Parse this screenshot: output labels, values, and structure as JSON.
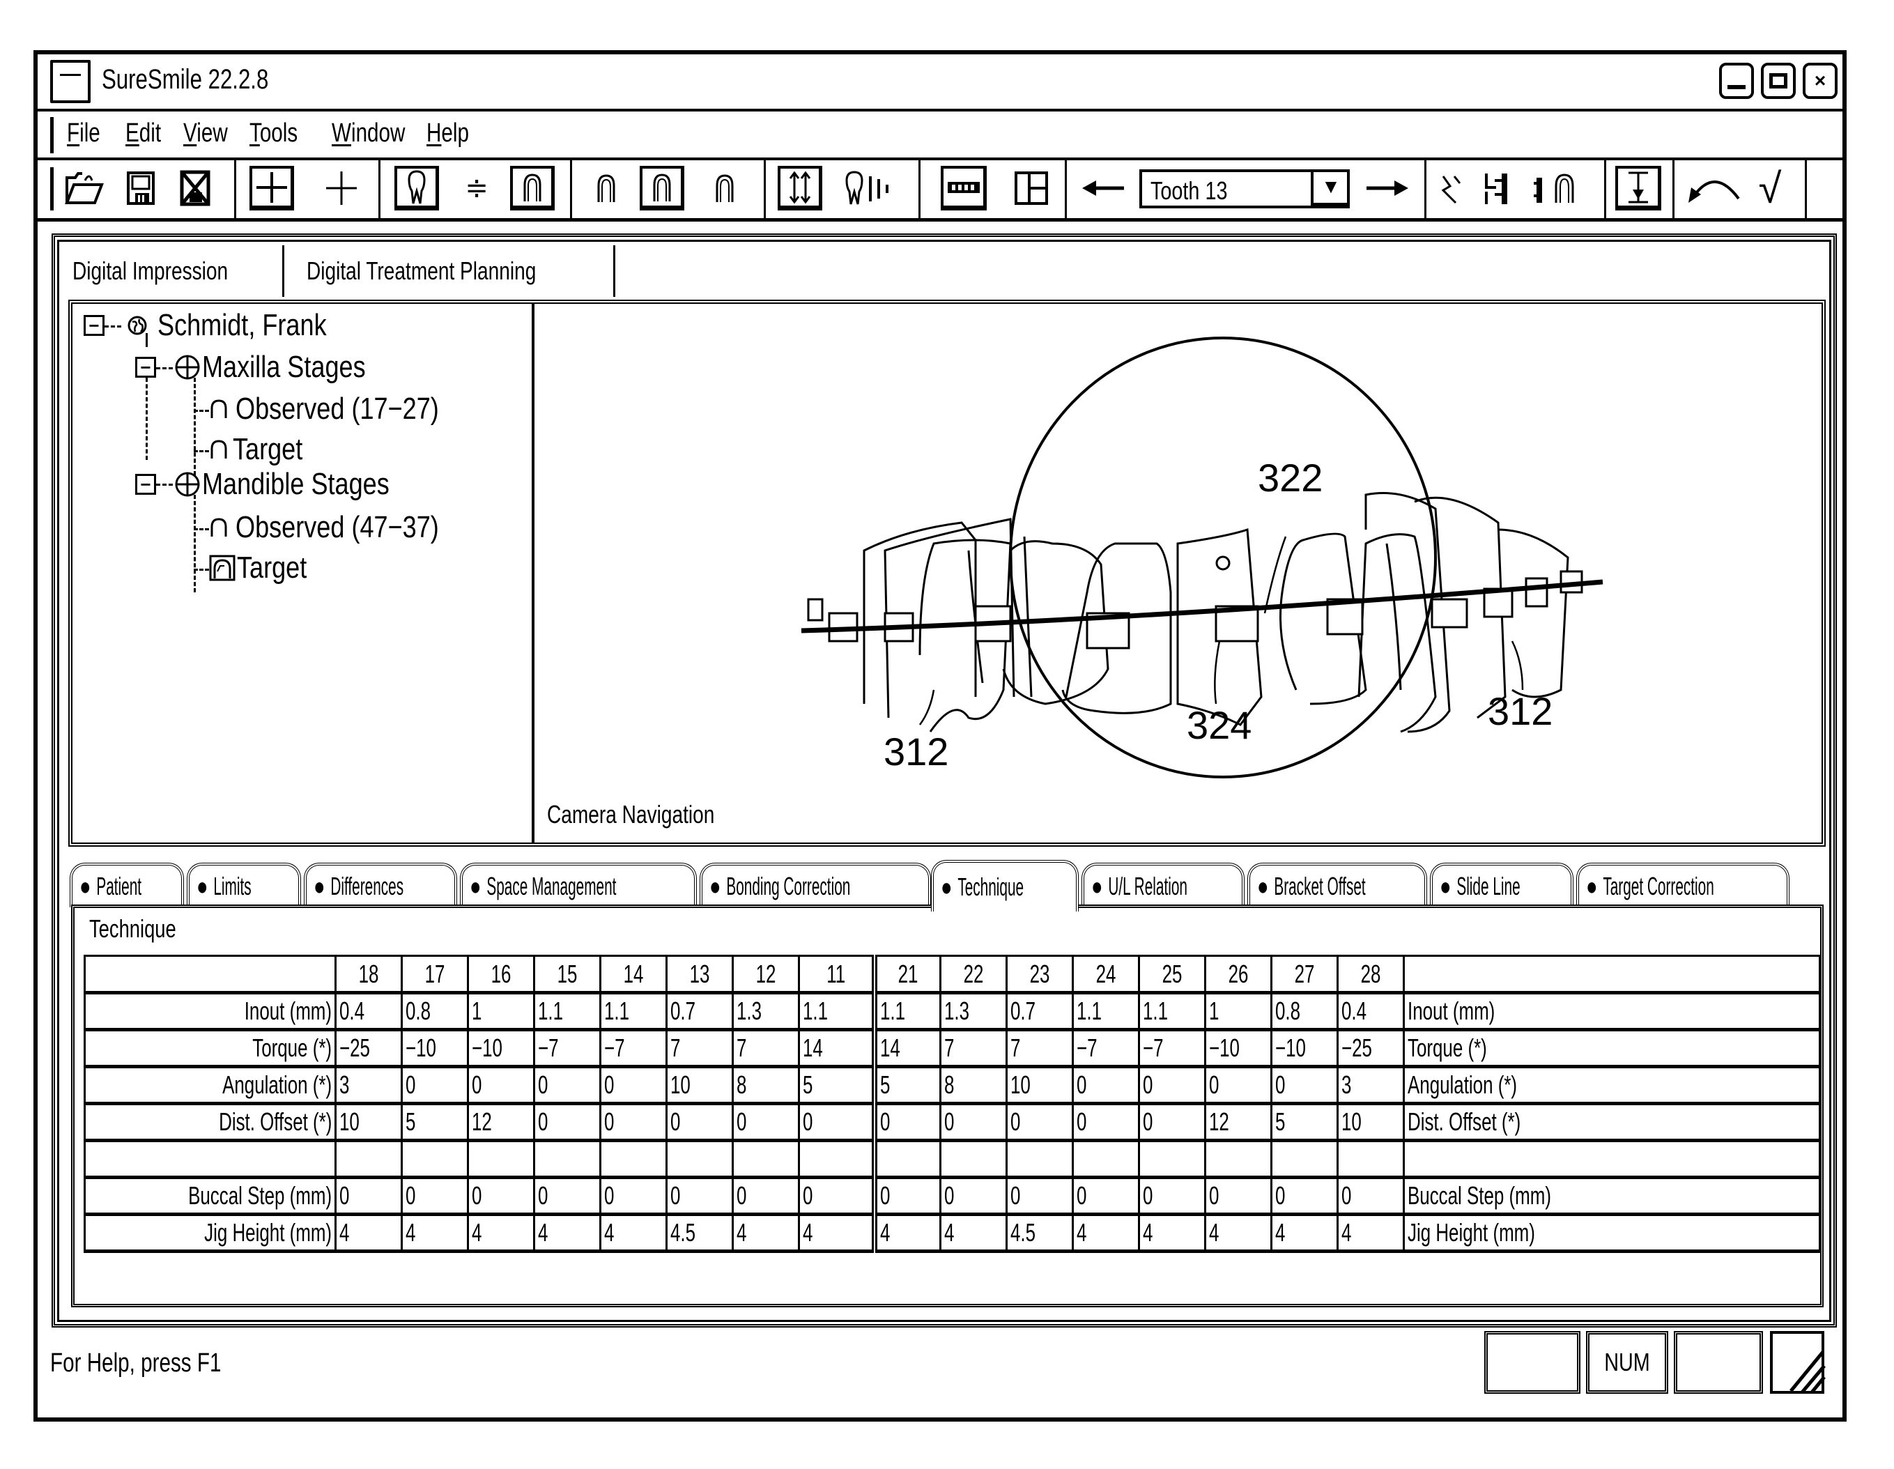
{
  "window": {
    "title": "SureSmile 22.2.8",
    "controls": {
      "minimize": "_",
      "maximize": "□",
      "close": "×"
    }
  },
  "menu": [
    {
      "label": "File",
      "mnemonic": "F",
      "rest": "ile"
    },
    {
      "label": "Edit",
      "mnemonic": "E",
      "rest": "dit"
    },
    {
      "label": "View",
      "mnemonic": "V",
      "rest": "iew"
    },
    {
      "label": "Tools",
      "mnemonic": "T",
      "rest": "ools"
    },
    {
      "label": "Window",
      "mnemonic": "W",
      "rest": "indow"
    },
    {
      "label": "Help",
      "mnemonic": "H",
      "rest": "elp"
    }
  ],
  "toolbar": {
    "icons": {
      "open": "open-folder-icon",
      "save": "save-icon",
      "close_doc": "close-document-icon",
      "add_boxed": "add-boxed-icon",
      "add": "add-icon",
      "tooth": "tooth-icon",
      "not_equal": "not-equal-icon",
      "arch_boxed": "arch-boxed-icon",
      "arch_upper": "arch-upper-icon",
      "arch_mid": "arch-boxed-icon",
      "arch_lower": "arch-lower-icon",
      "vertical_arrows": "vertical-arrows-icon",
      "tooth_ruler": "tooth-ruler-icon",
      "bracket_strip": "bracket-strip-icon",
      "split_view": "split-view-icon",
      "prev": "arrow-left-icon",
      "next": "arrow-right-icon",
      "wire_bend": "wire-bend-icon",
      "bracket_pair": "bracket-pair-icon",
      "bracket_arch": "bracket-arch-icon",
      "jig_down": "jig-down-icon",
      "undo": "undo-icon",
      "accept": "checkmark-icon"
    },
    "tooth_select": {
      "value": "Tooth 13",
      "dropdown": "▼"
    },
    "glyphs": {
      "prev": "←",
      "next": "→",
      "check": "√",
      "not_equal": "≑"
    }
  },
  "main_tabs": [
    {
      "label": "Digital Impression"
    },
    {
      "label": "Digital Treatment Planning"
    }
  ],
  "tree": {
    "root": "Schmidt, Frank",
    "maxilla": "Maxilla Stages",
    "maxilla_observed": "Observed (17−27)",
    "maxilla_target": "Target",
    "mandible": "Mandible Stages",
    "mandible_observed": "Observed (47−37)",
    "mandible_target": "Target",
    "expander": "−"
  },
  "viewport": {
    "label": "Camera Navigation",
    "callouts": [
      "322",
      "324",
      "312",
      "312"
    ]
  },
  "bottom_tabs": [
    {
      "label": "Patient"
    },
    {
      "label": "Limits"
    },
    {
      "label": "Differences"
    },
    {
      "label": "Space Management"
    },
    {
      "label": "Bonding Correction"
    },
    {
      "label": "Technique",
      "active": true
    },
    {
      "label": "U/L Relation"
    },
    {
      "label": "Bracket Offset"
    },
    {
      "label": "Slide Line"
    },
    {
      "label": "Target Correction"
    }
  ],
  "technique": {
    "title": "Technique",
    "teeth": [
      "18",
      "17",
      "16",
      "15",
      "14",
      "13",
      "12",
      "11",
      "21",
      "22",
      "23",
      "24",
      "25",
      "26",
      "27",
      "28"
    ],
    "rows": [
      {
        "label": "Inout (mm)",
        "values": [
          "0.4",
          "0.8",
          "1",
          "1.1",
          "1.1",
          "0.7",
          "1.3",
          "1.1",
          "1.1",
          "1.3",
          "0.7",
          "1.1",
          "1.1",
          "1",
          "0.8",
          "0.4"
        ]
      },
      {
        "label": "Torque (*)",
        "values": [
          "−25",
          "−10",
          "−10",
          "−7",
          "−7",
          "7",
          "7",
          "14",
          "14",
          "7",
          "7",
          "−7",
          "−7",
          "−10",
          "−10",
          "−25"
        ]
      },
      {
        "label": "Angulation (*)",
        "values": [
          "3",
          "0",
          "0",
          "0",
          "0",
          "10",
          "8",
          "5",
          "5",
          "8",
          "10",
          "0",
          "0",
          "0",
          "0",
          "3"
        ]
      },
      {
        "label": "Dist. Offset (*)",
        "values": [
          "10",
          "5",
          "12",
          "0",
          "0",
          "0",
          "0",
          "0",
          "0",
          "0",
          "0",
          "0",
          "0",
          "12",
          "5",
          "10"
        ]
      },
      {
        "label": "",
        "values": [
          "",
          "",
          "",
          "",
          "",
          "",
          "",
          "",
          "",
          "",
          "",
          "",
          "",
          "",
          "",
          ""
        ]
      },
      {
        "label": "Buccal Step (mm)",
        "values": [
          "0",
          "0",
          "0",
          "0",
          "0",
          "0",
          "0",
          "0",
          "0",
          "0",
          "0",
          "0",
          "0",
          "0",
          "0",
          "0"
        ]
      },
      {
        "label": "Jig Height (mm)",
        "values": [
          "4",
          "4",
          "4",
          "4",
          "4",
          "4.5",
          "4",
          "4",
          "4",
          "4",
          "4.5",
          "4",
          "4",
          "4",
          "4",
          "4"
        ]
      }
    ]
  },
  "status": {
    "help": "For Help, press F1",
    "panels": [
      "",
      "NUM",
      ""
    ]
  }
}
